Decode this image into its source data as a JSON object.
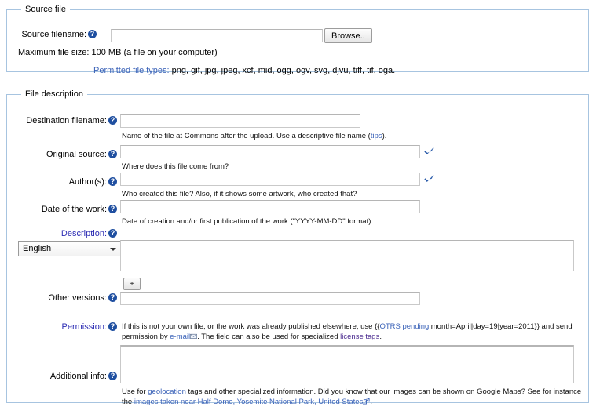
{
  "source_file": {
    "legend": "Source file",
    "filename_label": "Source filename:",
    "filename_value": "",
    "browse_label": "Browse..",
    "max_size_text": "Maximum file size: 100 MB (a file on your computer)",
    "permitted_label": "Permitted file types:",
    "permitted_types": "png, gif, jpg, jpeg, xcf, mid, ogg, ogv, svg, djvu, tiff, tif, oga.",
    "help_icon": "help-question-icon"
  },
  "file_description": {
    "legend": "File description",
    "destination": {
      "label": "Destination filename:",
      "value": "",
      "hint_pre": "Name of the file at Commons after the upload. Use a descriptive file name (",
      "hint_link": "tips",
      "hint_post": ")."
    },
    "original_source": {
      "label": "Original source:",
      "value": "",
      "hint": "Where does this file come from?",
      "check_icon": "blue-check-icon"
    },
    "authors": {
      "label": "Author(s):",
      "value": "",
      "hint": "Who created this file? Also, if it shows some artwork, who created that?",
      "check_icon": "blue-check-icon"
    },
    "date_of_work": {
      "label": "Date of the work:",
      "value": "",
      "hint": "Date of creation and/or first publication of the work (\"YYYY-MM-DD\" format)."
    },
    "description": {
      "label": "Description:",
      "language_selected": "English",
      "language_caret": "chevron-down-icon",
      "value": "",
      "add_label": "+"
    },
    "other_versions": {
      "label": "Other versions:",
      "value": ""
    },
    "permission": {
      "label": "Permission:",
      "hint_a": "If this is not your own file, or the work was already published elsewhere, use {{",
      "hint_link_otrs": "OTRS pending",
      "hint_b": "|month=April|day=19|year=2011}} and send permission by ",
      "hint_link_email": "e-mail",
      "hint_c": ". The field can also be used for specialized ",
      "hint_link_license": "license tags",
      "hint_d": ".",
      "value": ""
    },
    "additional_info": {
      "label": "Additional info:",
      "value": "",
      "hint_a": "Use for ",
      "hint_link_geo": "geolocation",
      "hint_b": " tags and other specialized information. Did you know that our images can be shown on Google Maps? See for instance the ",
      "hint_link_images": "images taken near Half Dome, Yosemite National Park, United States",
      "hint_c": "."
    }
  },
  "colors": {
    "fieldset_border": "#a7c4e0",
    "link_blue": "#3a62b8",
    "required_label": "#2b2bb3",
    "help_icon_blue": "#1f4fa0",
    "check_blue": "#2b5caa"
  }
}
